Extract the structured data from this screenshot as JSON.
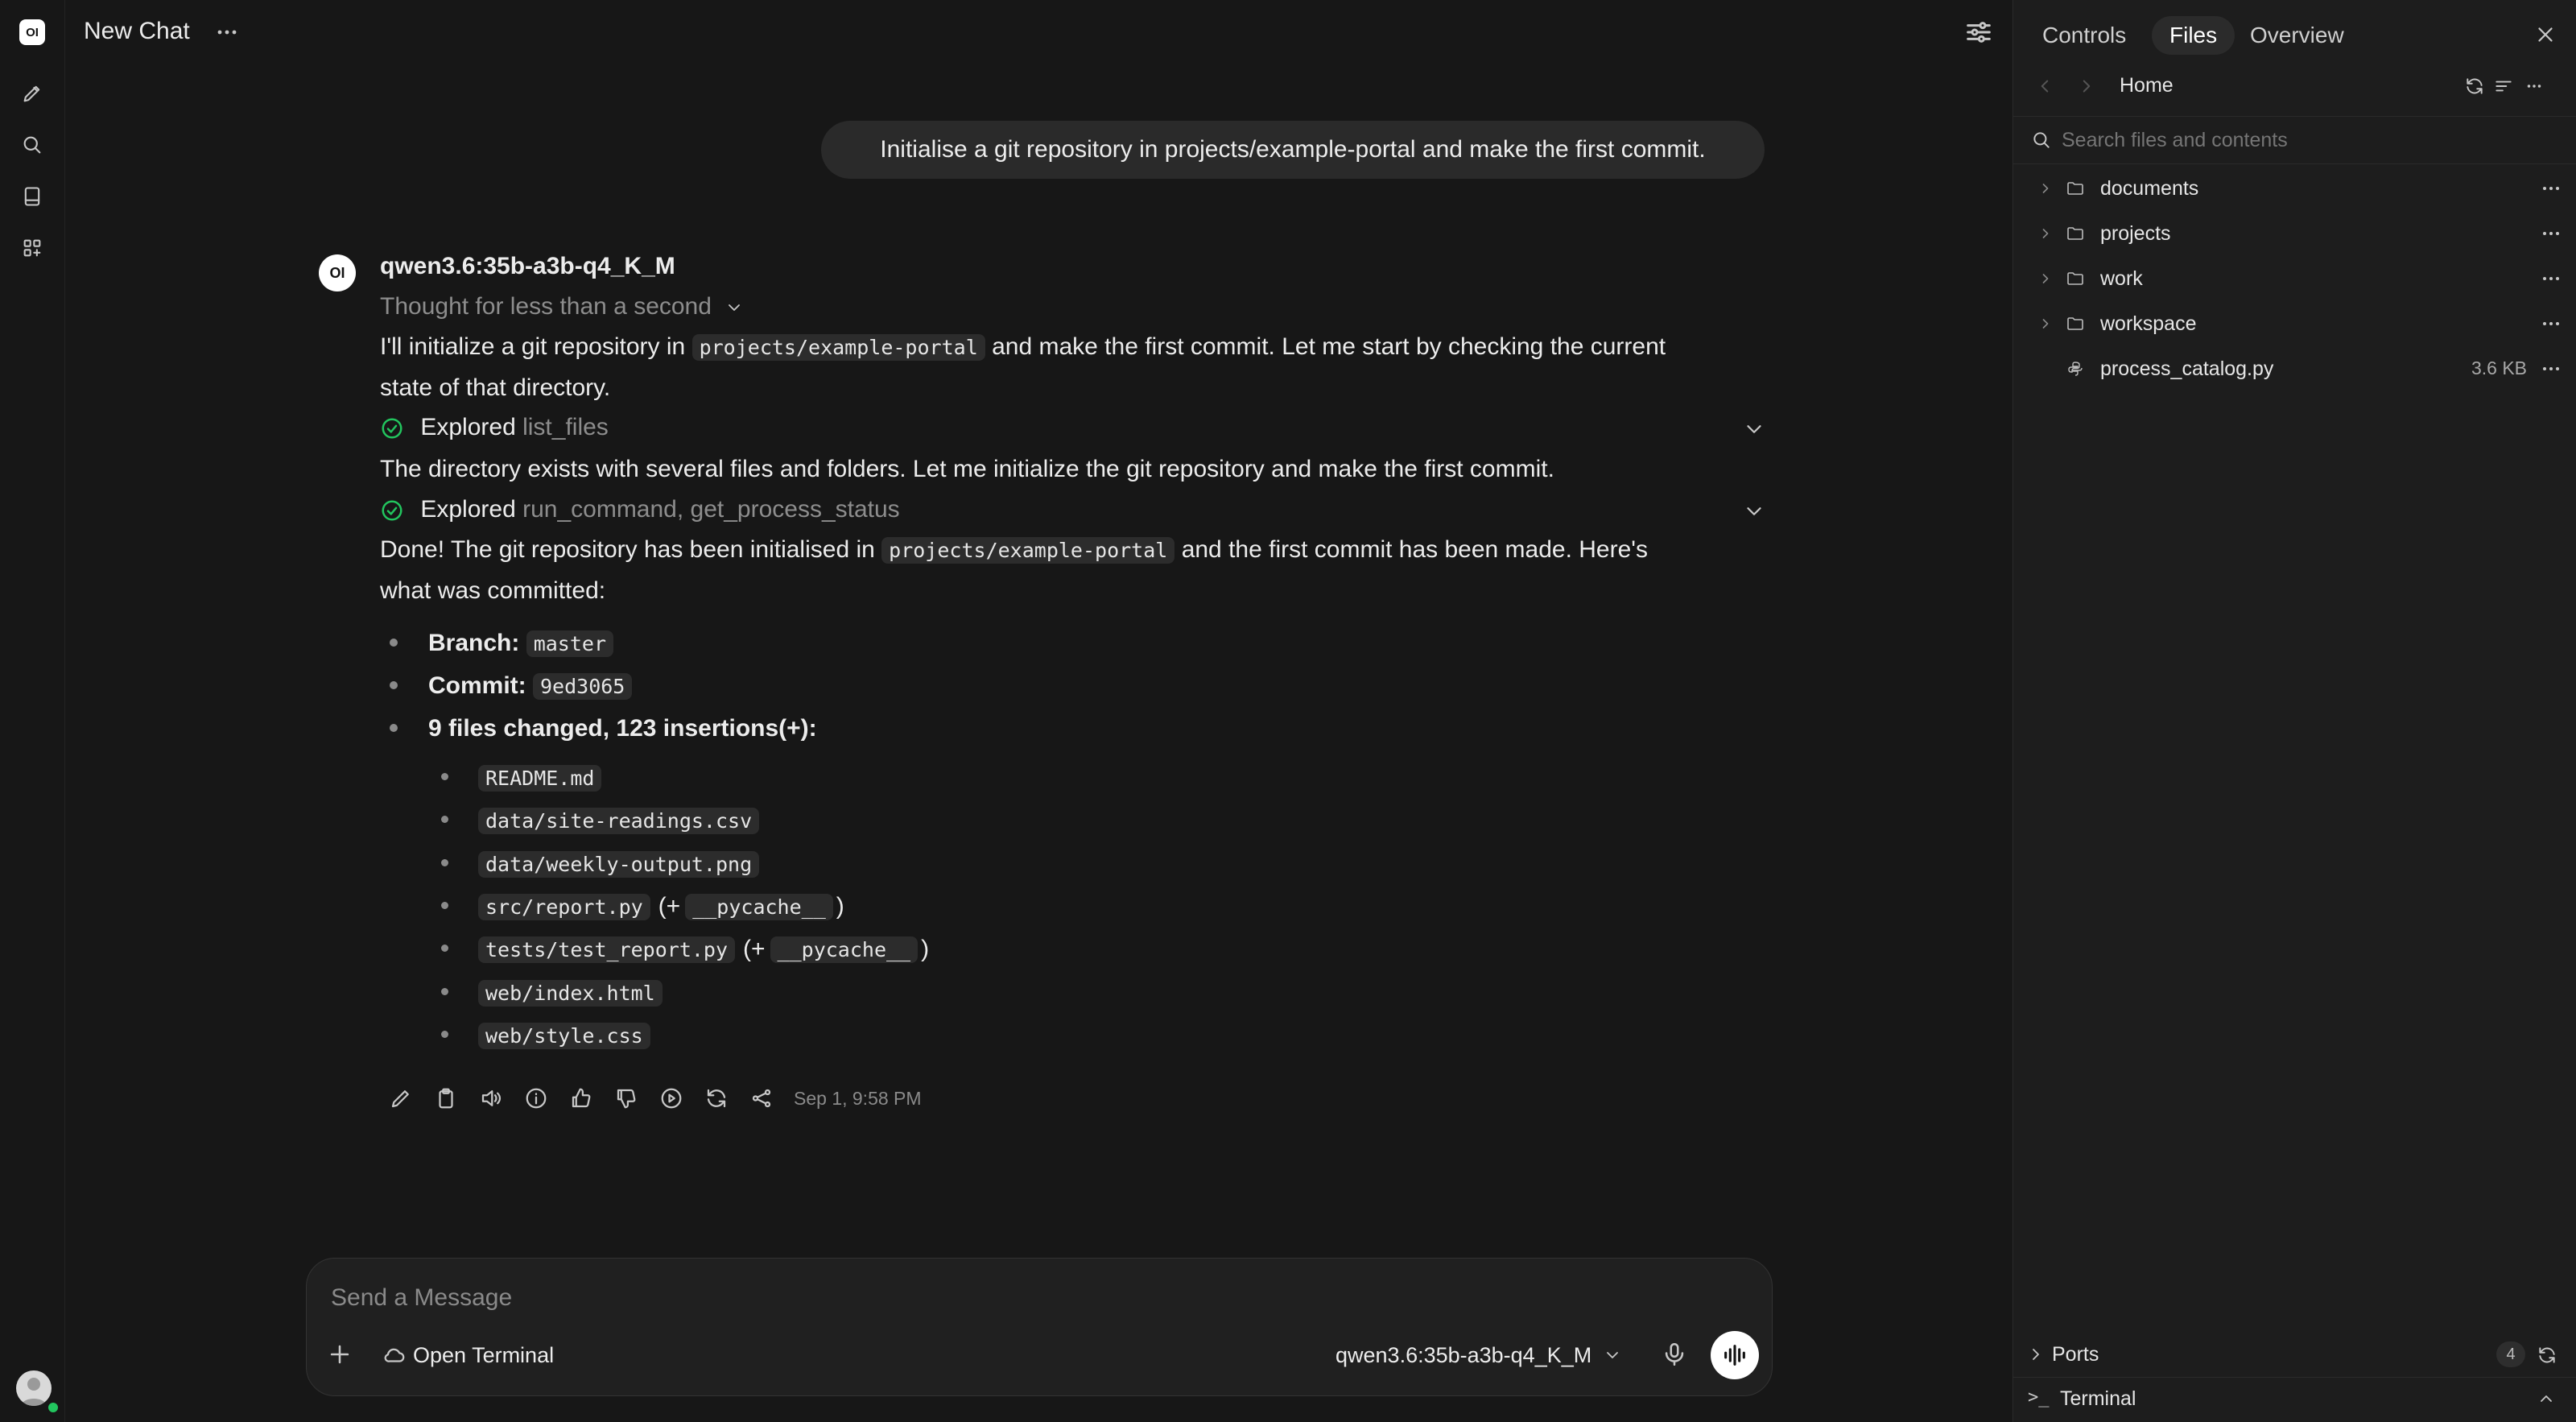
{
  "header": {
    "title": "New Chat"
  },
  "user_message": "Initialise a git repository in projects/example-portal and make the first commit.",
  "assistant": {
    "model": "qwen3.6:35b-a3b-q4_K_M",
    "avatar_text": "OI",
    "thought": "Thought for less than a second",
    "p1_a": "I'll initialize a git repository in",
    "p1_code": "projects/example-portal",
    "p1_b": "and make the first commit. Let me start by checking the current",
    "p1_c": "state of that directory.",
    "explored1_label": "Explored",
    "explored1_tools": "list_files",
    "p2": "The directory exists with several files and folders. Let me initialize the git repository and make the first commit.",
    "explored2_label": "Explored",
    "explored2_tools": "run_command, get_process_status",
    "p3_a": "Done! The git repository has been initialised in",
    "p3_code": "projects/example-portal",
    "p3_b": "and the first commit has been made. Here's",
    "p3_c": "what was committed:",
    "branch_label": "Branch:",
    "branch_value": "master",
    "commit_label": "Commit:",
    "commit_value": "9ed3065",
    "changes": "9 files changed, 123 insertions(+):",
    "files": [
      {
        "name": "README.md"
      },
      {
        "name": "data/site-readings.csv"
      },
      {
        "name": "data/weekly-output.png"
      },
      {
        "name": "src/report.py",
        "extra_open": "(+",
        "extra": "__pycache__",
        "extra_close": ")"
      },
      {
        "name": "tests/test_report.py",
        "extra_open": "(+",
        "extra": "__pycache__",
        "extra_close": ")"
      },
      {
        "name": "web/index.html"
      },
      {
        "name": "web/style.css"
      }
    ],
    "timestamp": "Sep 1, 9:58 PM"
  },
  "composer": {
    "placeholder": "Send a Message",
    "open_terminal": "Open Terminal",
    "model": "qwen3.6:35b-a3b-q4_K_M"
  },
  "panel": {
    "tabs": [
      "Controls",
      "Files",
      "Overview"
    ],
    "active_tab": "Files",
    "breadcrumb": "Home",
    "search_placeholder": "Search files and contents",
    "tree": [
      {
        "name": "documents",
        "type": "folder"
      },
      {
        "name": "projects",
        "type": "folder"
      },
      {
        "name": "work",
        "type": "folder"
      },
      {
        "name": "workspace",
        "type": "folder"
      },
      {
        "name": "process_catalog.py",
        "type": "file",
        "size": "3.6 KB"
      }
    ],
    "ports_label": "Ports",
    "ports_count": "4",
    "terminal_label": "Terminal"
  },
  "colors": {
    "background": "#171717",
    "panel": "#1d1d1d",
    "accent_green": "#22c55e"
  }
}
